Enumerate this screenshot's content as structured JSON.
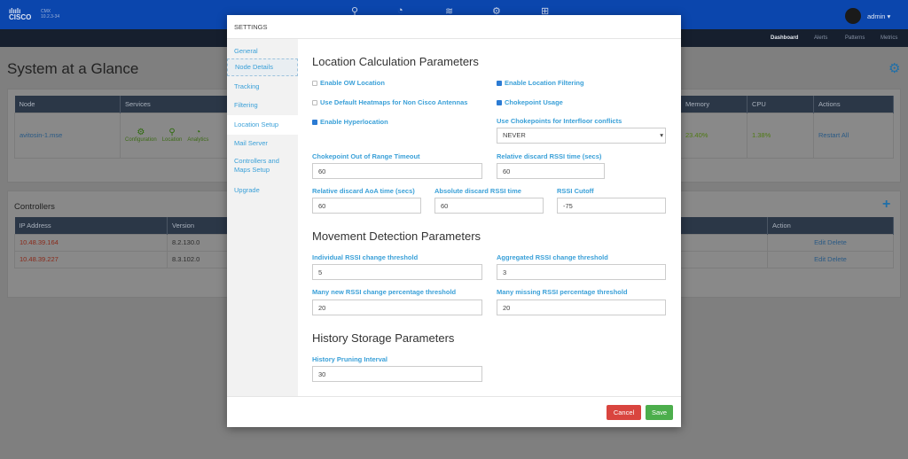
{
  "header": {
    "brand": "CISCO",
    "product": "CMX",
    "version": "10.2.3-34",
    "user": "admin",
    "icons": [
      "location-pin-icon",
      "analytics-gauge-icon",
      "wifi-icon",
      "settings-gears-icon",
      "network-icon"
    ]
  },
  "nav": [
    "Dashboard",
    "Alerts",
    "Patterns",
    "Metrics"
  ],
  "page": {
    "title": "System at a Glance"
  },
  "nodes": {
    "columns": [
      "Node",
      "Services",
      "Memory",
      "CPU",
      "Actions"
    ],
    "row": {
      "node": "avitosin-1.mse",
      "services": [
        "Configuration",
        "Location",
        "Analytics"
      ],
      "memory": "23.40%",
      "cpu": "1.38%",
      "action": "Restart All"
    }
  },
  "controllers": {
    "title": "Controllers",
    "columns": [
      "IP Address",
      "Version",
      "Action"
    ],
    "rows": [
      {
        "ip": "10.48.39.164",
        "version": "8.2.130.0",
        "action": "Edit Delete"
      },
      {
        "ip": "10.48.39.227",
        "version": "8.3.102.0",
        "action": "Edit Delete"
      }
    ]
  },
  "modal": {
    "title": "SETTINGS",
    "sidebar": [
      "General",
      "Node Details",
      "Tracking",
      "Filtering",
      "Location Setup",
      "Mail Server",
      "Controllers and Maps Setup",
      "Upgrade"
    ],
    "active": "Location Setup",
    "loc": {
      "title": "Location Calculation Parameters",
      "ow": {
        "label": "Enable OW Location",
        "checked": false
      },
      "heatmaps": {
        "label": "Use Default Heatmaps for Non Cisco Antennas",
        "checked": false
      },
      "hyper": {
        "label": "Enable Hyperlocation",
        "checked": true
      },
      "filtering": {
        "label": "Enable Location Filtering",
        "checked": true
      },
      "choke": {
        "label": "Chokepoint Usage",
        "checked": true
      },
      "interfloor": {
        "label": "Use Chokepoints for Interfloor conflicts",
        "value": "NEVER"
      },
      "chokeTimeout": {
        "label": "Chokepoint Out of Range Timeout",
        "value": "60"
      },
      "relRssi": {
        "label": "Relative discard RSSI time (secs)",
        "value": "60"
      },
      "relAoa": {
        "label": "Relative discard AoA time (secs)",
        "value": "60"
      },
      "absRssi": {
        "label": "Absolute discard RSSI time",
        "value": "60"
      },
      "cutoff": {
        "label": "RSSI Cutoff",
        "value": "-75"
      }
    },
    "move": {
      "title": "Movement Detection Parameters",
      "indiv": {
        "label": "Individual RSSI change threshold",
        "value": "5"
      },
      "aggr": {
        "label": "Aggregated RSSI change threshold",
        "value": "3"
      },
      "newpct": {
        "label": "Many new RSSI change percentage threshold",
        "value": "20"
      },
      "misspct": {
        "label": "Many missing RSSI percentage threshold",
        "value": "20"
      }
    },
    "hist": {
      "title": "History Storage Parameters",
      "prune": {
        "label": "History Pruning Interval",
        "value": "30"
      }
    },
    "cancel": "Cancel",
    "save": "Save"
  },
  "colors": {
    "cancel": "#d9453f",
    "save": "#4cae4c",
    "link": "#3aa0d8",
    "topbar": "#0b46ad"
  }
}
